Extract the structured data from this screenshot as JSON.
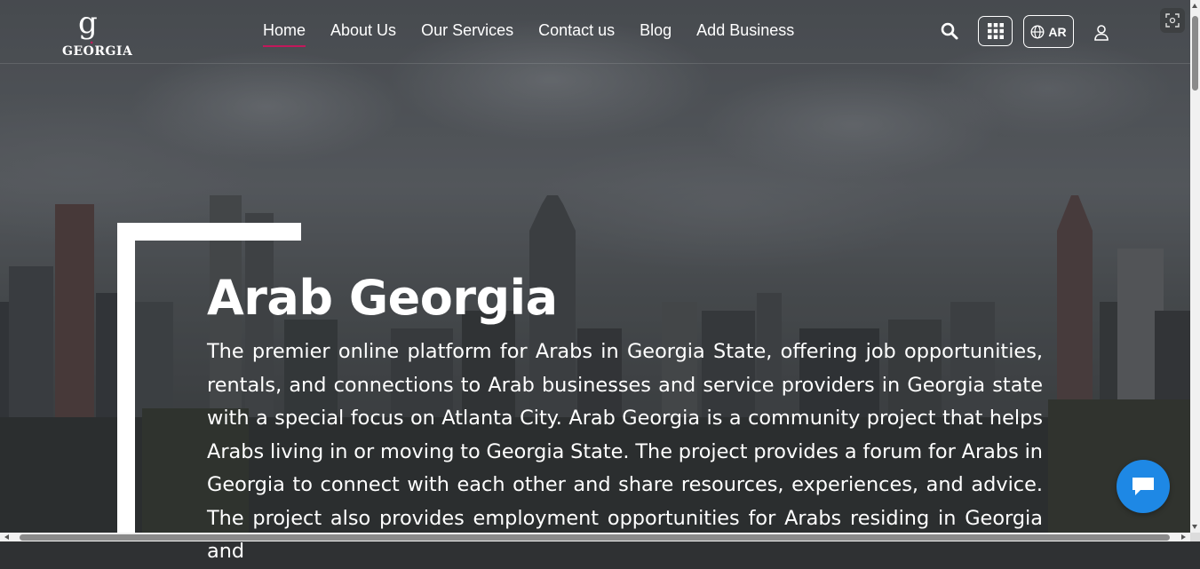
{
  "header": {
    "logo_text": "GEORGIA",
    "nav": [
      {
        "label": "Home",
        "active": true
      },
      {
        "label": "About Us",
        "active": false
      },
      {
        "label": "Our Services",
        "active": false
      },
      {
        "label": "Contact us",
        "active": false
      },
      {
        "label": "Blog",
        "active": false
      },
      {
        "label": "Add Business",
        "active": false
      }
    ],
    "language_label": "AR",
    "icons": {
      "search": "search-icon",
      "apps": "apps-grid-icon",
      "language": "globe-icon",
      "user": "user-icon",
      "screenshot": "screenshot-icon"
    }
  },
  "hero": {
    "title": "Arab Georgia",
    "description": "The premier online platform for Arabs in Georgia State, offering job opportunities, rentals, and connections to Arab businesses and service providers in Georgia state with a special focus on Atlanta City. Arab Georgia is a community project that helps Arabs living in or moving to Georgia State. The project provides a forum for Arabs in Georgia to connect with each other and share resources, experiences, and advice. The project also provides employment opportunities for Arabs residing in Georgia and"
  },
  "chat": {
    "icon": "chat-bubble-icon"
  },
  "colors": {
    "accent": "#c2185b",
    "chat": "#1e88e5"
  }
}
